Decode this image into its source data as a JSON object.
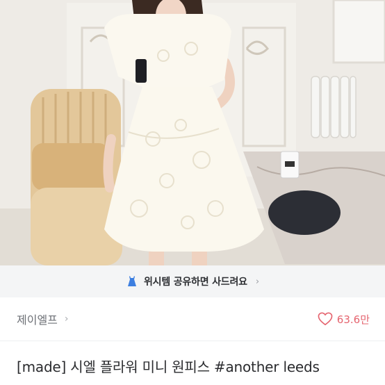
{
  "product": {
    "image_alt": "white lace mini dress photo",
    "title": "[made] 시엘 플라워 미니 원피스 #another leeds"
  },
  "wish_banner": {
    "text": "위시템 공유하면 사드려요",
    "icon": "dress-icon",
    "chevron": "›"
  },
  "seller": {
    "name": "제이엘프",
    "chevron": "›",
    "like_icon": "heart-outline-icon",
    "like_count": "63.6만"
  },
  "colors": {
    "accent": "#e5646f",
    "banner_bg": "#f4f5f6",
    "dress_icon": "#3d7fe0"
  }
}
